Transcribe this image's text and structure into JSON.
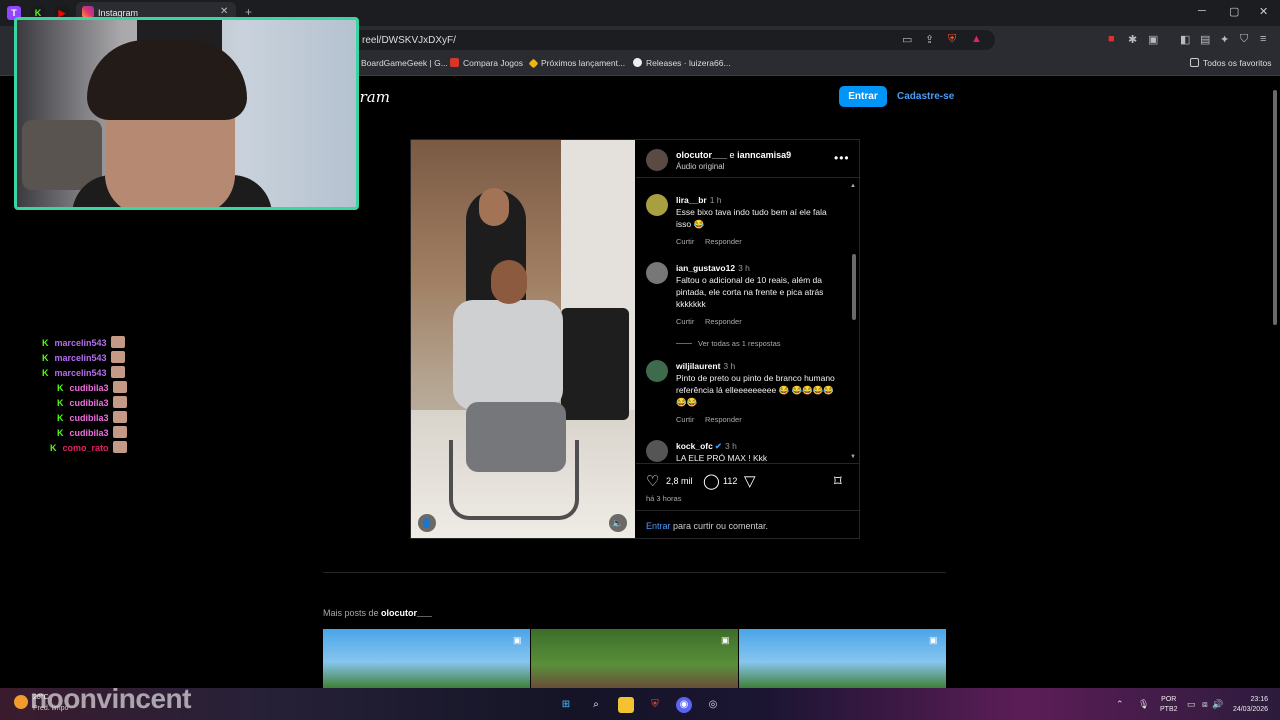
{
  "browser": {
    "tab_title": "Instagram",
    "url": "reel/DWSKVJxDXyF/",
    "bookmarks": [
      "BoardGameGeek | G...",
      "Compara Jogos",
      "Próximos lançament...",
      "Releases · luizera66..."
    ],
    "favorites_label": "Todos os favoritos"
  },
  "instagram": {
    "logo": "gram",
    "login_button": "Entrar",
    "signup_link": "Cadastre-se",
    "post": {
      "header_user": "olocutor___",
      "header_and": "e",
      "header_collab": "ianncamisa9",
      "audio": "Áudio original",
      "comments": [
        {
          "user": "lira__br",
          "time": "1 h",
          "text": "Esse bixo tava indo tudo bem aí ele fala isso 😂",
          "like": "Curtir",
          "reply": "Responder"
        },
        {
          "user": "ian_gustavo12",
          "time": "3 h",
          "text": "Faltou o adicional de 10 reais, além da pintada, ele corta na frente e pica atrás kkkkkkk",
          "like": "Curtir",
          "reply": "Responder",
          "view_replies": "Ver todas as 1 respostas"
        },
        {
          "user": "wiljilaurent",
          "time": "3 h",
          "text": "Pinto de preto ou pinto de branco humano referência lá elleeeeeeeee 😂 😂😂😂😂😂😂",
          "like": "Curtir",
          "reply": "Responder"
        },
        {
          "user": "kock_ofc",
          "time": "3 h",
          "text": "LA ELE PRÓ MAX ! Kkk"
        }
      ],
      "likes": "2,8 mil",
      "comment_count": "112",
      "time_ago": "há 3 horas",
      "login_link": "Entrar",
      "login_suffix": " para curtir ou comentar."
    },
    "more_posts_prefix": "Mais posts de ",
    "more_posts_user": "olocutor___"
  },
  "chat": [
    {
      "name": "marcelin543",
      "color": "#b46cf0",
      "indent": 0
    },
    {
      "name": "marcelin543",
      "color": "#b46cf0",
      "indent": 0
    },
    {
      "name": "marcelin543",
      "color": "#b46cf0",
      "indent": 0
    },
    {
      "name": "cudibila3",
      "color": "#ee6fe0",
      "indent": 1
    },
    {
      "name": "cudibila3",
      "color": "#ee6fe0",
      "indent": 1
    },
    {
      "name": "cudibila3",
      "color": "#ee6fe0",
      "indent": 1
    },
    {
      "name": "cudibila3",
      "color": "#ee6fe0",
      "indent": 1
    },
    {
      "name": "como_rato",
      "color": "#e0245e",
      "indent": 2
    }
  ],
  "taskbar": {
    "temp": "28°C",
    "weather": "Pred. limpo",
    "streamer": "noonvincent",
    "lang1": "POR",
    "lang2": "PTB2",
    "time": "23:16",
    "date": "24/03/2026"
  }
}
